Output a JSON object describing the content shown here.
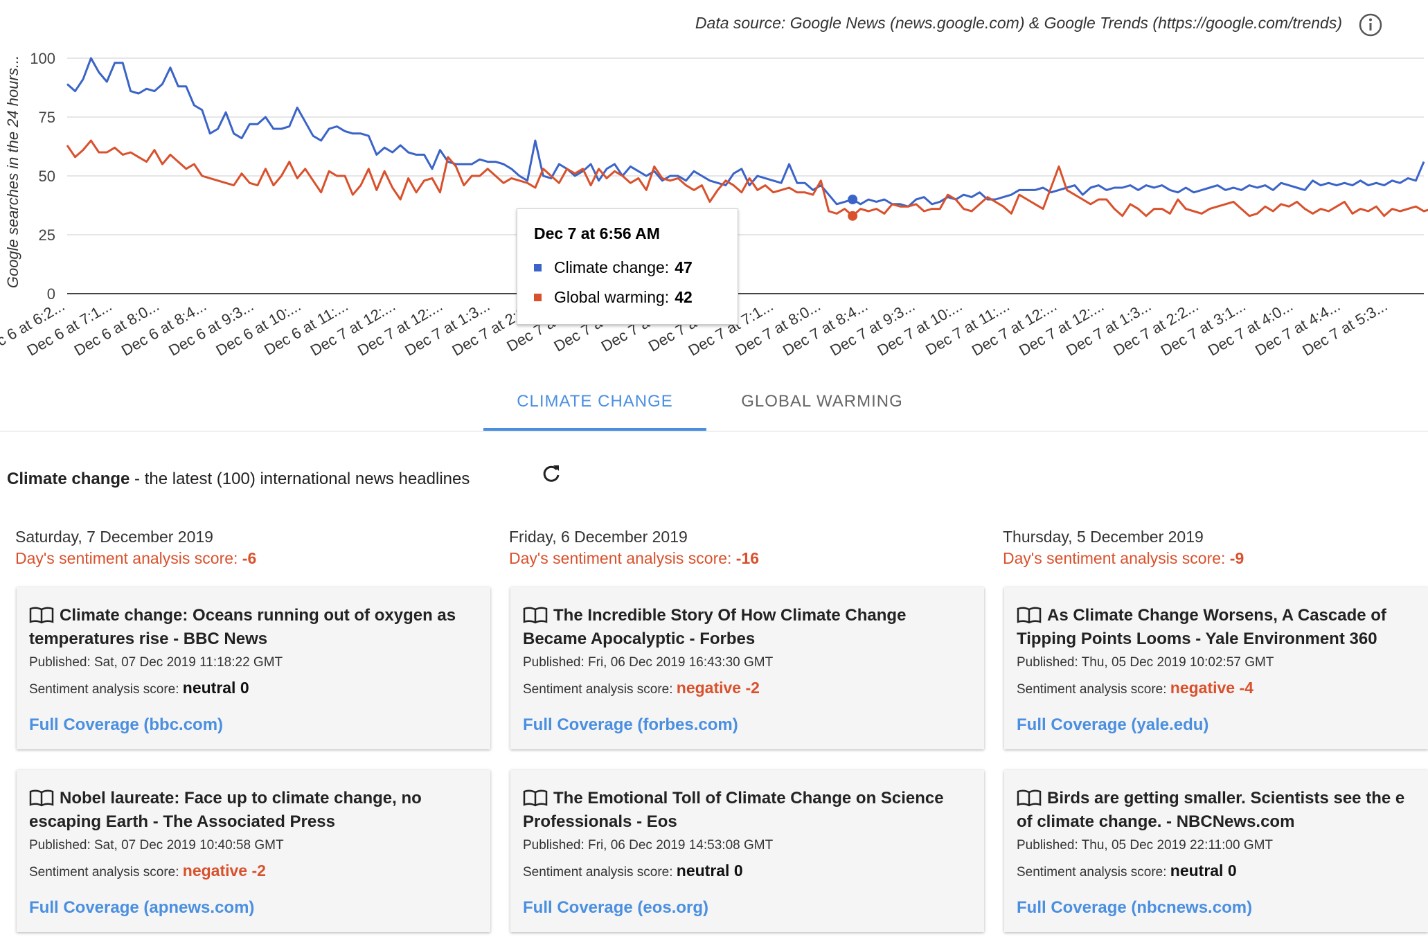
{
  "header": {
    "data_source": "Data source: Google News (news.google.com) & Google Trends (https://google.com/trends)"
  },
  "chart_data": {
    "type": "line",
    "ylabel": "Google searches in the 24 hours...",
    "ylim": [
      0,
      100
    ],
    "yticks": [
      0,
      25,
      50,
      75,
      100
    ],
    "grid": true,
    "colors": {
      "Climate change": "#3b64c8",
      "Global warming": "#d9512c"
    },
    "x_tick_labels": [
      "Dec 6 at 6:2...",
      "Dec 6 at 7:1...",
      "Dec 6 at 8:0...",
      "Dec 6 at 8:4...",
      "Dec 6 at 9:3...",
      "Dec 6 at 10:...",
      "Dec 6 at 11:...",
      "Dec 7 at 12:...",
      "Dec 7 at 12:...",
      "Dec 7 at 1:3...",
      "Dec 7 at 2:2...",
      "Dec 7 at 3:...",
      "Dec 7 at 4:...",
      "Dec 7 at 5:...",
      "Dec 7 at 6:...",
      "Dec 7 at 7:1...",
      "Dec 7 at 8:0...",
      "Dec 7 at 8:4...",
      "Dec 7 at 9:3...",
      "Dec 7 at 10:...",
      "Dec 7 at 11:...",
      "Dec 7 at 12:...",
      "Dec 7 at 12:...",
      "Dec 7 at 1:3...",
      "Dec 7 at 2:2...",
      "Dec 7 at 3:1...",
      "Dec 7 at 4:0...",
      "Dec 7 at 4:4...",
      "Dec 7 at 5:3..."
    ],
    "series": [
      {
        "name": "Climate change",
        "values": [
          89,
          86,
          91,
          100,
          94,
          90,
          98,
          98,
          86,
          85,
          87,
          86,
          89,
          96,
          88,
          88,
          80,
          78,
          68,
          70,
          77,
          68,
          66,
          72,
          72,
          75,
          70,
          70,
          71,
          79,
          73,
          67,
          65,
          70,
          71,
          69,
          68,
          68,
          67,
          59,
          62,
          60,
          63,
          60,
          59,
          59,
          53,
          61,
          56,
          55,
          55,
          55,
          57,
          56,
          56,
          55,
          53,
          50,
          48,
          65,
          50,
          49,
          55,
          53,
          50,
          52,
          55,
          48,
          53,
          55,
          50,
          54,
          52,
          50,
          52,
          48,
          50,
          50,
          48,
          52,
          50,
          48,
          47,
          46,
          51,
          53,
          46,
          50,
          49,
          48,
          47,
          55,
          47,
          47,
          44,
          46,
          42,
          38,
          39,
          40,
          38,
          40,
          39,
          40,
          38,
          38,
          37,
          40,
          41,
          38,
          39,
          41,
          40,
          42,
          41,
          43,
          40,
          40,
          41,
          42,
          44,
          44,
          44,
          45,
          43,
          44,
          45,
          46,
          42,
          45,
          46,
          44,
          45,
          45,
          46,
          44,
          46,
          45,
          46,
          44,
          43,
          45,
          43,
          44,
          45,
          46,
          44,
          45,
          44,
          46,
          45,
          46,
          44,
          47,
          46,
          45,
          44,
          48,
          46,
          47,
          46,
          47,
          46,
          48,
          46,
          47,
          46,
          48,
          47,
          49,
          48,
          56
        ]
      },
      {
        "name": "Global warming",
        "values": [
          63,
          58,
          61,
          65,
          60,
          60,
          62,
          59,
          60,
          58,
          56,
          61,
          55,
          59,
          56,
          53,
          55,
          50,
          49,
          48,
          47,
          46,
          51,
          47,
          46,
          53,
          46,
          50,
          56,
          49,
          53,
          48,
          43,
          52,
          50,
          50,
          42,
          46,
          53,
          44,
          52,
          45,
          40,
          49,
          43,
          48,
          49,
          43,
          58,
          54,
          46,
          50,
          50,
          53,
          50,
          47,
          49,
          48,
          47,
          45,
          53,
          50,
          47,
          53,
          51,
          53,
          46,
          53,
          49,
          52,
          50,
          47,
          49,
          44,
          54,
          49,
          48,
          49,
          46,
          44,
          46,
          39,
          44,
          48,
          46,
          43,
          49,
          44,
          46,
          43,
          44,
          45,
          43,
          43,
          42,
          48,
          35,
          34,
          36,
          33,
          36,
          35,
          36,
          34,
          38,
          37,
          37,
          38,
          35,
          36,
          36,
          42,
          40,
          36,
          35,
          38,
          41,
          39,
          37,
          34,
          42,
          40,
          38,
          36,
          45,
          54,
          44,
          42,
          40,
          38,
          40,
          40,
          36,
          33,
          38,
          36,
          33,
          36,
          36,
          34,
          40,
          36,
          35,
          34,
          36,
          37,
          38,
          39,
          36,
          33,
          34,
          37,
          35,
          38,
          37,
          39,
          36,
          34,
          36,
          35,
          37,
          39,
          34,
          36,
          35,
          37,
          33,
          36,
          35,
          36,
          37,
          35,
          36,
          38,
          40,
          43
        ]
      }
    ],
    "highlight_index": 99
  },
  "tooltip": {
    "title": "Dec 7 at 6:56 AM",
    "cc_label": "Climate change:",
    "cc_value": "47",
    "gw_label": "Global warming:",
    "gw_value": "42"
  },
  "tabs": [
    {
      "label": "CLIMATE CHANGE",
      "active": true
    },
    {
      "label": "GLOBAL WARMING",
      "active": false
    }
  ],
  "headlines": {
    "topic": "Climate change",
    "rest": " - the latest (100) international news headlines"
  },
  "days": [
    {
      "date": "Saturday, 7 December 2019",
      "score_label": "Day's sentiment analysis score: ",
      "score": "-6",
      "articles": [
        {
          "title": "Climate change: Oceans running out of oxygen as temperatures rise - BBC News",
          "published": "Published: Sat, 07 Dec 2019 11:18:22 GMT",
          "sent_label": "Sentiment analysis score: ",
          "sentiment": "neutral 0",
          "link": "Full Coverage (bbc.com)"
        },
        {
          "title": "Nobel laureate: Face up to climate change, no escaping Earth - The Associated Press",
          "published": "Published: Sat, 07 Dec 2019 10:40:58 GMT",
          "sent_label": "Sentiment analysis score: ",
          "sentiment": "negative -2",
          "link": "Full Coverage (apnews.com)"
        }
      ]
    },
    {
      "date": "Friday, 6 December 2019",
      "score_label": "Day's sentiment analysis score: ",
      "score": "-16",
      "articles": [
        {
          "title": "The Incredible Story Of How Climate Change Became Apocalyptic - Forbes",
          "published": "Published: Fri, 06 Dec 2019 16:43:30 GMT",
          "sent_label": "Sentiment analysis score: ",
          "sentiment": "negative -2",
          "link": "Full Coverage (forbes.com)"
        },
        {
          "title": "The Emotional Toll of Climate Change on Science Professionals - Eos",
          "published": "Published: Fri, 06 Dec 2019 14:53:08 GMT",
          "sent_label": "Sentiment analysis score: ",
          "sentiment": "neutral 0",
          "link": "Full Coverage (eos.org)"
        }
      ]
    },
    {
      "date": "Thursday, 5 December 2019",
      "score_label": "Day's sentiment analysis score: ",
      "score": "-9",
      "articles": [
        {
          "title": "As Climate Change Worsens, A Cascade of Tipping Points Looms - Yale Environment 360",
          "published": "Published: Thu, 05 Dec 2019 10:02:57 GMT",
          "sent_label": "Sentiment analysis score: ",
          "sentiment": "negative -4",
          "link": "Full Coverage (yale.edu)"
        },
        {
          "title": "Birds are getting smaller. Scientists see the e of climate change. - NBCNews.com",
          "published": "Published: Thu, 05 Dec 2019 22:11:00 GMT",
          "sent_label": "Sentiment analysis score: ",
          "sentiment": "neutral 0",
          "link": "Full Coverage (nbcnews.com)"
        }
      ]
    }
  ]
}
